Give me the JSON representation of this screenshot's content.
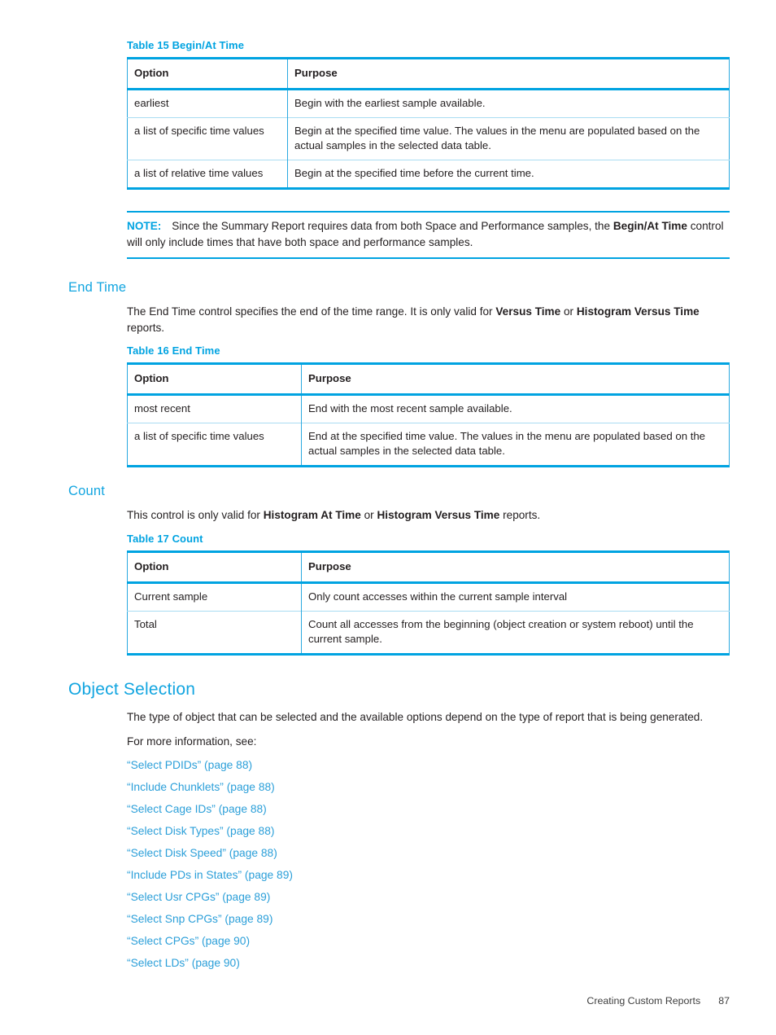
{
  "doc": {
    "footer_title": "Creating Custom Reports",
    "page_number": "87"
  },
  "table15": {
    "caption": "Table 15 Begin/At Time",
    "headers": [
      "Option",
      "Purpose"
    ],
    "rows": [
      [
        "earliest",
        "Begin with the earliest sample available."
      ],
      [
        "a list of specific time values",
        "Begin at the specified time value. The values in the menu are populated based on the actual samples in the selected data table."
      ],
      [
        "a list of relative time values",
        "Begin at the specified time before the current time."
      ]
    ]
  },
  "note": {
    "label": "NOTE:",
    "text_part1": "Since the Summary Report requires data from both Space and Performance samples, the ",
    "bold_term": "Begin/At Time",
    "text_part2": " control will only include times that have both space and performance samples."
  },
  "end_time": {
    "heading": "End Time",
    "body_part1": "The End Time control specifies the end of the time range. It is only valid for ",
    "bold1": "Versus Time",
    "body_part2": " or ",
    "bold2": "Histogram Versus Time",
    "body_part3": " reports."
  },
  "table16": {
    "caption": "Table 16 End Time",
    "headers": [
      "Option",
      "Purpose"
    ],
    "rows": [
      [
        "most recent",
        "End with the most recent sample available."
      ],
      [
        "a list of specific time values",
        "End at the specified time value. The values in the menu are populated based on the actual samples in the selected data table."
      ]
    ]
  },
  "count": {
    "heading": "Count",
    "body_part1": "This control is only valid for ",
    "bold1": "Histogram At Time",
    "body_part2": " or ",
    "bold2": "Histogram Versus Time",
    "body_part3": " reports."
  },
  "table17": {
    "caption": "Table 17 Count",
    "headers": [
      "Option",
      "Purpose"
    ],
    "rows": [
      [
        "Current sample",
        "Only count accesses within the current sample interval"
      ],
      [
        "Total",
        "Count all accesses from the beginning (object creation or system reboot) until the current sample."
      ]
    ]
  },
  "object_selection": {
    "heading": "Object Selection",
    "intro": "The type of object that can be selected and the available options depend on the type of report that is being generated.",
    "see_also_label": "For more information, see:",
    "links": [
      "“Select PDIDs” (page 88)",
      "“Include Chunklets” (page 88)",
      "“Select Cage IDs” (page 88)",
      "“Select Disk Types” (page 88)",
      "“Select Disk Speed” (page 88)",
      "“Include PDs in States” (page 89)",
      "“Select Usr CPGs” (page 89)",
      "“Select Snp CPGs” (page 89)",
      "“Select CPGs” (page 90)",
      "“Select LDs” (page 90)"
    ]
  },
  "colors": {
    "accent": "#00a3e1",
    "heading": "#12a5e0",
    "link": "#2b9fd9",
    "rule_light": "#a9dcf2",
    "text": "#231f20"
  }
}
